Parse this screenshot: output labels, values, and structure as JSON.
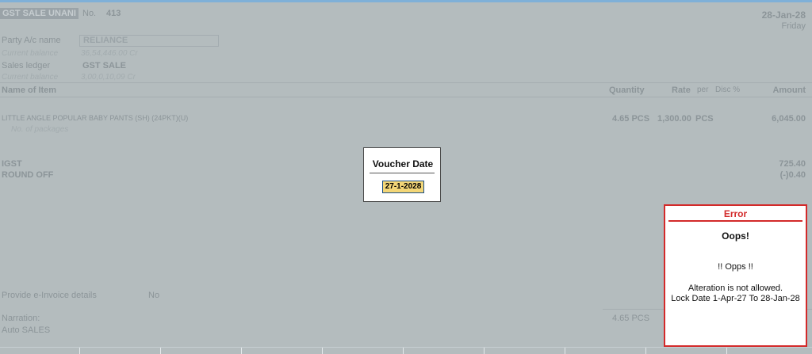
{
  "voucher": {
    "type": "GST SALE UNANI",
    "no_label": "No.",
    "no": "413",
    "date": "28-Jan-28",
    "day": "Friday"
  },
  "party": {
    "label": "Party A/c name",
    "value": "RELIANCE",
    "balance_label": "Current balance",
    "balance": "36,54,446.00 Cr"
  },
  "sales_ledger": {
    "label": "Sales ledger",
    "value": "GST SALE",
    "balance_label": "Current balance",
    "balance": "3,00,0,10,09 Cr"
  },
  "columns": {
    "name": "Name of Item",
    "quantity": "Quantity",
    "rate": "Rate",
    "per": "per",
    "disc": "Disc %",
    "amount": "Amount"
  },
  "items": [
    {
      "name": "LITTLE ANGLE POPULAR BABY PANTS (SH) (24PKT)(U)",
      "packages": "No. of packages",
      "quantity": "4.65 PCS",
      "rate": "1,300.00",
      "per": "PCS",
      "amount": "6,045.00"
    }
  ],
  "taxes": [
    {
      "name": "IGST",
      "amount": "725.40"
    },
    {
      "name": "ROUND OFF",
      "amount": "(-)0.40"
    }
  ],
  "einvoice": {
    "label": "Provide e-Invoice details",
    "value": "No"
  },
  "narration": {
    "label": "Narration:",
    "value": "Auto SALES"
  },
  "total_qty": "4.65 PCS",
  "date_dialog": {
    "title": "Voucher Date",
    "value": "27-1-2028"
  },
  "error": {
    "title": "Error",
    "heading": "Oops!",
    "line1": "!! Opps !!",
    "line2": "Alteration is not allowed.",
    "line3": "Lock Date 1-Apr-27 To 28-Jan-28"
  },
  "colors": {
    "error_red": "#d32a2a",
    "date_highlight": "#f3d677",
    "background": "#b4bcbe"
  }
}
